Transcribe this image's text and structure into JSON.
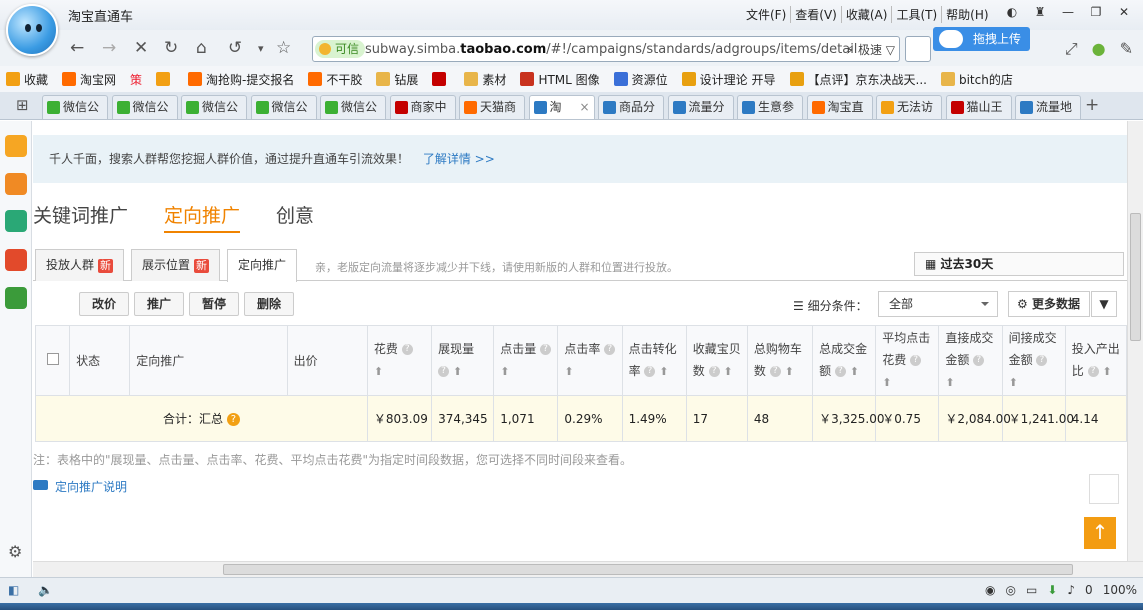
{
  "window": {
    "title": "淘宝直通车",
    "menu": [
      "文件(F)",
      "查看(V)",
      "收藏(A)",
      "工具(T)",
      "帮助(H)"
    ]
  },
  "address_bar": {
    "secure_label": "可信",
    "url_prefix": "subway.simba.",
    "url_domain": "taobao.com",
    "url_suffix": "/#!/campaigns/standards/adgroups/items/detail",
    "speed_label": "极速"
  },
  "upload_tooltip": "拖拽上传",
  "bookmarks": [
    {
      "label": "收藏",
      "icon": "star-icon",
      "color": "#f2a014"
    },
    {
      "label": "淘宝网",
      "icon": "taobao-icon",
      "color": "#ff6a00"
    },
    {
      "label": "策",
      "icon": "",
      "color": "#e23"
    },
    {
      "label": "",
      "icon": "warning-icon",
      "color": "#f2a014"
    },
    {
      "label": "淘抢购-提交报名",
      "icon": "taobao-icon",
      "color": "#ff6a00"
    },
    {
      "label": "不干胶",
      "icon": "taobao-icon",
      "color": "#ff6a00"
    },
    {
      "label": "钻展",
      "icon": "folder-icon",
      "color": "#e8b54a"
    },
    {
      "label": "",
      "icon": "tmall-icon",
      "color": "#c40000"
    },
    {
      "label": "素材",
      "icon": "folder-icon",
      "color": "#e8b54a"
    },
    {
      "label": "HTML 图像",
      "icon": "w3-icon",
      "color": "#c8321e"
    },
    {
      "label": "资源位",
      "icon": "diamond-icon",
      "color": "#3a6fd8"
    },
    {
      "label": "设计理论 开导",
      "icon": "lightning-icon",
      "color": "#e8a010"
    },
    {
      "label": "【点评】京东决战天...",
      "icon": "lightning-icon",
      "color": "#e8a010"
    },
    {
      "label": "bitch的店",
      "icon": "folder-icon",
      "color": "#e8b54a"
    }
  ],
  "tabs": [
    {
      "label": "微信公",
      "icon": "wechat-icon",
      "color": "#3cb034"
    },
    {
      "label": "微信公",
      "icon": "wechat-icon",
      "color": "#3cb034"
    },
    {
      "label": "微信公",
      "icon": "wechat-icon",
      "color": "#3cb034"
    },
    {
      "label": "微信公",
      "icon": "wechat-icon",
      "color": "#3cb034"
    },
    {
      "label": "微信公",
      "icon": "wechat-icon",
      "color": "#3cb034"
    },
    {
      "label": "商家中",
      "icon": "tmall-icon",
      "color": "#c40000"
    },
    {
      "label": "天猫商",
      "icon": "taobao-icon",
      "color": "#ff6a00"
    },
    {
      "label": "淘",
      "icon": "page-icon",
      "color": "#2d7ac3",
      "active": true
    },
    {
      "label": "商品分",
      "icon": "page-icon",
      "color": "#2d7ac3"
    },
    {
      "label": "流量分",
      "icon": "page-icon",
      "color": "#2d7ac3"
    },
    {
      "label": "生意参",
      "icon": "page-icon",
      "color": "#2d7ac3"
    },
    {
      "label": "淘宝直",
      "icon": "taobao-icon",
      "color": "#ff6a00"
    },
    {
      "label": "无法访",
      "icon": "warning-icon",
      "color": "#f2a014"
    },
    {
      "label": "猫山王",
      "icon": "tmall-icon",
      "color": "#c40000"
    },
    {
      "label": "流量地",
      "icon": "page-icon",
      "color": "#2d7ac3"
    }
  ],
  "notice": {
    "text": "千人千面，搜索人群帮您挖掘人群价值，通过提升直通车引流效果！",
    "link": "了解详情 >>"
  },
  "main_tabs": [
    {
      "label": "关键词推广",
      "active": false
    },
    {
      "label": "定向推广",
      "active": true
    },
    {
      "label": "创意",
      "active": false
    }
  ],
  "sub_tabs": [
    {
      "label": "投放人群",
      "badge": "新"
    },
    {
      "label": "展示位置",
      "badge": "新"
    },
    {
      "label": "定向推广",
      "badge": "",
      "active": true
    }
  ],
  "sub_tab_note": "亲，老版定向流量将逐步减少并下线，请使用新版的人群和位置进行投放。",
  "date_range": "过去30天",
  "toolbar": {
    "buttons": [
      "改价",
      "推广",
      "暂停",
      "删除"
    ],
    "filter_label": "细分条件：",
    "filter_value": "全部",
    "more_data": "更多数据"
  },
  "table": {
    "headers": [
      {
        "label": "",
        "type": "checkbox"
      },
      {
        "label": "状态"
      },
      {
        "label": "定向推广"
      },
      {
        "label": "出价"
      },
      {
        "label": "花费",
        "sortable": true
      },
      {
        "label": "展现量",
        "sortable": true
      },
      {
        "label": "点击量",
        "sortable": true
      },
      {
        "label": "点击率",
        "sortable": true
      },
      {
        "label": "点击转化率",
        "sortable": true
      },
      {
        "label": "收藏宝贝数",
        "sortable": true
      },
      {
        "label": "总购物车数",
        "sortable": true
      },
      {
        "label": "总成交金额",
        "sortable": true
      },
      {
        "label": "平均点击花费",
        "sortable": true
      },
      {
        "label": "直接成交金额",
        "sortable": true
      },
      {
        "label": "间接成交金额",
        "sortable": true
      },
      {
        "label": "投入产出比",
        "sortable": true
      }
    ],
    "summary_row": {
      "label": "合计：汇总",
      "values": [
        "￥803.09",
        "374,345",
        "1,071",
        "0.29%",
        "1.49%",
        "17",
        "48",
        "￥3,325.00",
        "￥0.75",
        "￥2,084.00",
        "￥1,241.00",
        "4.14"
      ]
    }
  },
  "footnote": "注：表格中的\"展现量、点击量、点击率、花费、平均点击花费\"为指定时间段数据，您可选择不同时间段来查看。",
  "help_link": "定向推广说明",
  "status_bar": {
    "zoom": "100%",
    "count": "0"
  },
  "colors": {
    "accent": "#f08300",
    "link": "#2d7ac3",
    "summary_bg": "#fefbe8",
    "notice_bg": "#e9f2f7"
  }
}
